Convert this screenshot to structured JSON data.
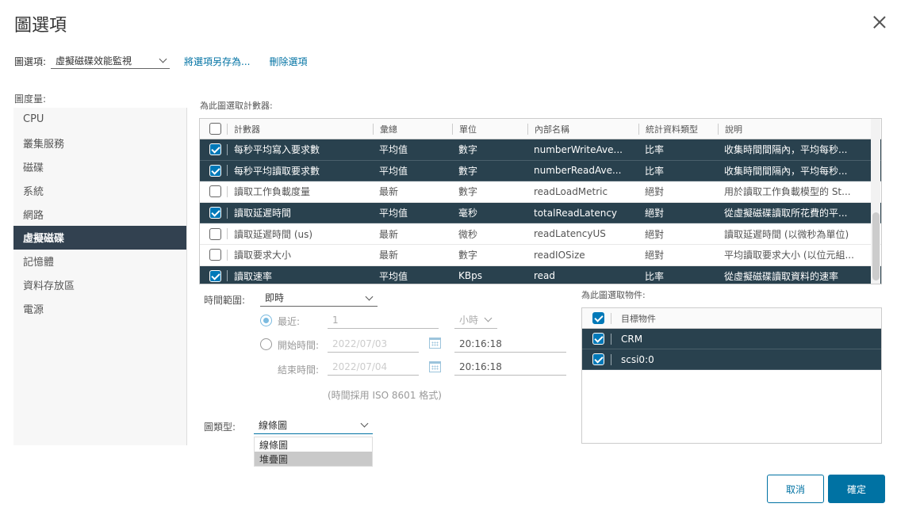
{
  "dialog": {
    "title": "圖選項",
    "close_icon": "close-icon"
  },
  "options": {
    "label": "圖選項:",
    "selected": "虛擬磁碟效能監視",
    "save_as": "將選項另存為...",
    "delete": "刪除選項"
  },
  "sidebar": {
    "label": "圖度量:",
    "items": [
      "CPU",
      "叢集服務",
      "磁碟",
      "系統",
      "網路",
      "虛擬磁碟",
      "記憶體",
      "資料存放區",
      "電源"
    ],
    "active": "虛擬磁碟"
  },
  "counters": {
    "title": "為此圖選取計數器:",
    "headers": [
      "計數器",
      "彙總",
      "單位",
      "內部名稱",
      "統計資料類型",
      "說明"
    ],
    "rows": [
      {
        "checked": true,
        "name": "每秒平均寫入要求數",
        "rollup": "平均值",
        "unit": "數字",
        "internal": "numberWriteAve...",
        "stat": "比率",
        "desc": "收集時間間隔內，平均每秒..."
      },
      {
        "checked": true,
        "name": "每秒平均讀取要求數",
        "rollup": "平均值",
        "unit": "數字",
        "internal": "numberReadAve...",
        "stat": "比率",
        "desc": "收集時間間隔內，平均每秒..."
      },
      {
        "checked": false,
        "name": "讀取工作負載度量",
        "rollup": "最新",
        "unit": "數字",
        "internal": "readLoadMetric",
        "stat": "絕對",
        "desc": "用於讀取工作負載模型的 St..."
      },
      {
        "checked": true,
        "name": "讀取延遲時間",
        "rollup": "平均值",
        "unit": "毫秒",
        "internal": "totalReadLatency",
        "stat": "絕對",
        "desc": "從虛擬磁碟讀取所花費的平..."
      },
      {
        "checked": false,
        "name": "讀取延遲時間 (us)",
        "rollup": "最新",
        "unit": "微秒",
        "internal": "readLatencyUS",
        "stat": "絕對",
        "desc": "讀取延遲時間 (以微秒為單位)"
      },
      {
        "checked": false,
        "name": "讀取要求大小",
        "rollup": "最新",
        "unit": "數字",
        "internal": "readIOSize",
        "stat": "絕對",
        "desc": "平均讀取要求大小 (以位元組..."
      },
      {
        "checked": true,
        "name": "讀取速率",
        "rollup": "平均值",
        "unit": "KBps",
        "internal": "read",
        "stat": "比率",
        "desc": "從虛擬磁碟讀取資料的速率"
      }
    ]
  },
  "timespan": {
    "label": "時間範圍:",
    "selected": "即時",
    "last_label": "最近:",
    "last_value": "1",
    "last_unit": "小時",
    "from_label": "開始時間:",
    "from_date": "2022/07/03",
    "from_time": "20:16:18",
    "to_label": "結束時間:",
    "to_date": "2022/07/04",
    "to_time": "20:16:18",
    "note": "(時間採用 ISO 8601 格式)"
  },
  "charttype": {
    "label": "圖類型:",
    "selected": "線條圖",
    "options": [
      "線條圖",
      "堆疊圖"
    ]
  },
  "objects": {
    "title": "為此圖選取物件:",
    "header": "目標物件",
    "rows": [
      "CRM",
      "scsi0:0"
    ]
  },
  "buttons": {
    "cancel": "取消",
    "ok": "確定"
  },
  "colors": {
    "accent": "#0072a3",
    "selected_row": "#29414e",
    "sidebar_active": "#324150"
  }
}
